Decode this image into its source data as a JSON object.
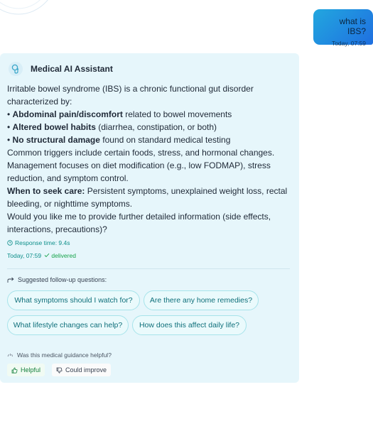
{
  "user_message": {
    "text": "what is IBS?",
    "timestamp": "Today, 07:59"
  },
  "assistant": {
    "name": "Medical AI Assistant",
    "avatar_icon": "brain-stethoscope-icon",
    "intro": "Irritable bowel syndrome (IBS) is a chronic functional gut disorder characterized by:",
    "bullets": [
      {
        "bold": "Abdominal pain/discomfort",
        "rest": " related to bowel movements"
      },
      {
        "bold": "Altered bowel habits",
        "rest": " (diarrhea, constipation, or both)"
      },
      {
        "bold": "No structural damage",
        "rest": " found on standard medical testing"
      }
    ],
    "triggers": "Common triggers include certain foods, stress, and hormonal changes.",
    "management": "Management focuses on diet modification (e.g., low FODMAP), stress reduction, and symptom control.",
    "seek_care_label": "When to seek care:",
    "seek_care_text": " Persistent symptoms, unexplained weight loss, rectal bleeding, or nighttime symptoms.",
    "follow_up": "Would you like me to provide further detailed information (side effects, interactions, precautions)?",
    "response_time": "Response time: 9.4s",
    "timestamp": "Today, 07:59",
    "status": "delivered"
  },
  "suggestions": {
    "label": "Suggested follow-up questions:",
    "items": [
      "What symptoms should I watch for?",
      "Are there any home remedies?",
      "What lifestyle changes can help?",
      "How does this affect daily life?"
    ]
  },
  "feedback": {
    "question": "Was this medical guidance helpful?",
    "helpful_label": "Helpful",
    "improve_label": "Could improve"
  },
  "colors": {
    "user_bubble_start": "#22a7df",
    "user_bubble_end": "#1f6fe0",
    "card_bg": "#e6f6fb",
    "accent": "#0e8f8a",
    "success": "#16a34a"
  }
}
